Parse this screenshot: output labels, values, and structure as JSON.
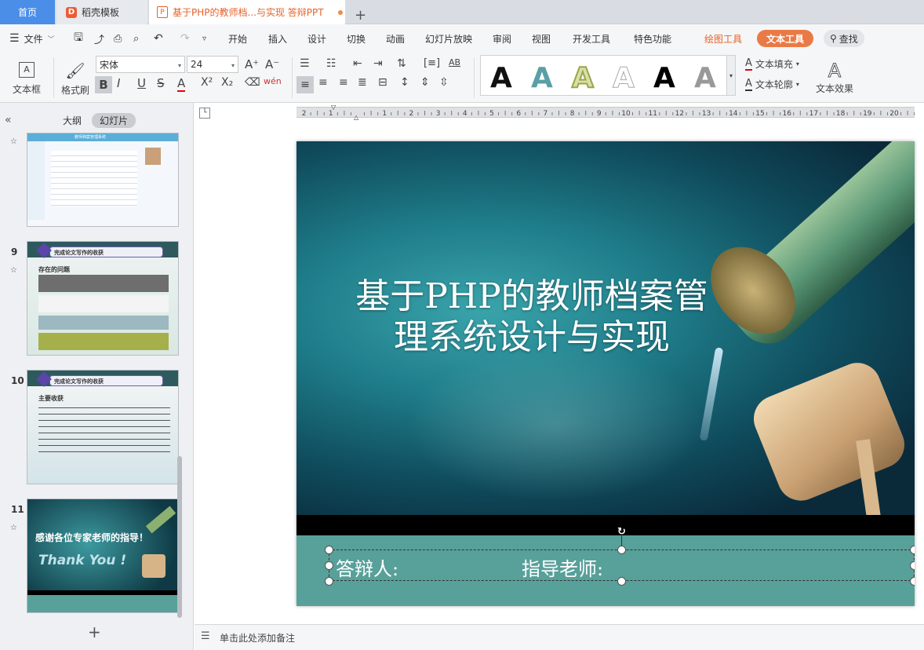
{
  "tabs": {
    "home": "首页",
    "template": "稻壳模板",
    "document": "基于PHP的教师档...与实现 答辩PPT",
    "add": "+"
  },
  "menu": {
    "file": "文件",
    "items": [
      "开始",
      "插入",
      "设计",
      "切换",
      "动画",
      "幻灯片放映",
      "审阅",
      "视图",
      "开发工具",
      "特色功能"
    ],
    "draw_tools": "绘图工具",
    "text_tools": "文本工具",
    "search": "查找"
  },
  "ribbon": {
    "textbox": "文本框",
    "format_painter": "格式刷",
    "font_name": "宋体",
    "font_size": "24",
    "text_fill": "文本填充",
    "text_outline": "文本轮廓",
    "text_effect": "文本效果",
    "style_glyph": "A"
  },
  "left_panel": {
    "outline_tab": "大纲",
    "slides_tab": "幻灯片",
    "slides": [
      {
        "number": "",
        "title": "教师档案管理系统"
      },
      {
        "number": "9",
        "title": "完成论文写作的收获",
        "subtitle": "存在的问题"
      },
      {
        "number": "10",
        "title": "完成论文写作的收获",
        "subtitle": "主要收获"
      },
      {
        "number": "11",
        "title": "感谢各位专家老师的指导！",
        "subtitle": "Thank You !"
      }
    ],
    "add_slide": "+"
  },
  "slide": {
    "title_line1": "基于PHP的教师档案管",
    "title_line2": "理系统设计与实现",
    "presenter_label": "答辩人:",
    "advisor_label": "指导老师:"
  },
  "notes": {
    "placeholder": "单击此处添加备注"
  },
  "colors": {
    "accent_blue": "#4a8ee8",
    "accent_orange": "#ea7a45",
    "slide_teal": "#58a09a"
  }
}
